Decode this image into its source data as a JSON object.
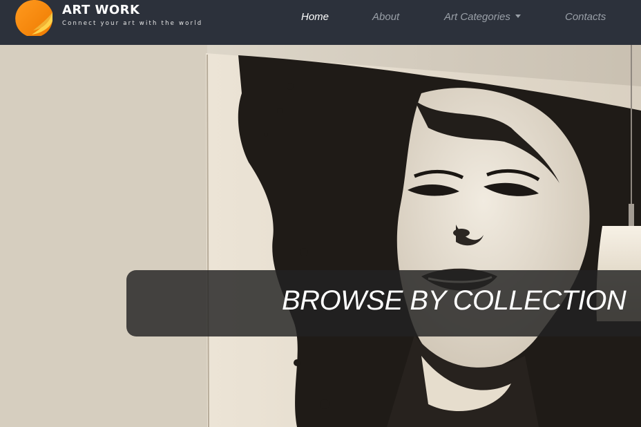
{
  "brand": {
    "title": "ART WORK",
    "tagline": "Connect your art with the world",
    "logo_icon": "peeling-sticker-logo-icon",
    "logo_color": "#f7941d"
  },
  "nav": {
    "items": [
      {
        "label": "Home",
        "active": true
      },
      {
        "label": "About",
        "active": false
      },
      {
        "label": "Art Categories",
        "active": false,
        "has_dropdown": true
      },
      {
        "label": "Contacts",
        "active": false
      }
    ]
  },
  "hero": {
    "banner_text": "BROWSE BY COLLECTION",
    "image_subject": "black-and-white woman portrait painting on wall with hanging lamp"
  },
  "colors": {
    "navbar_bg": "#2c313b",
    "nav_active": "#ffffff",
    "nav_inactive": "#9aa0a8",
    "banner_bg": "rgba(34,34,34,0.82)"
  }
}
